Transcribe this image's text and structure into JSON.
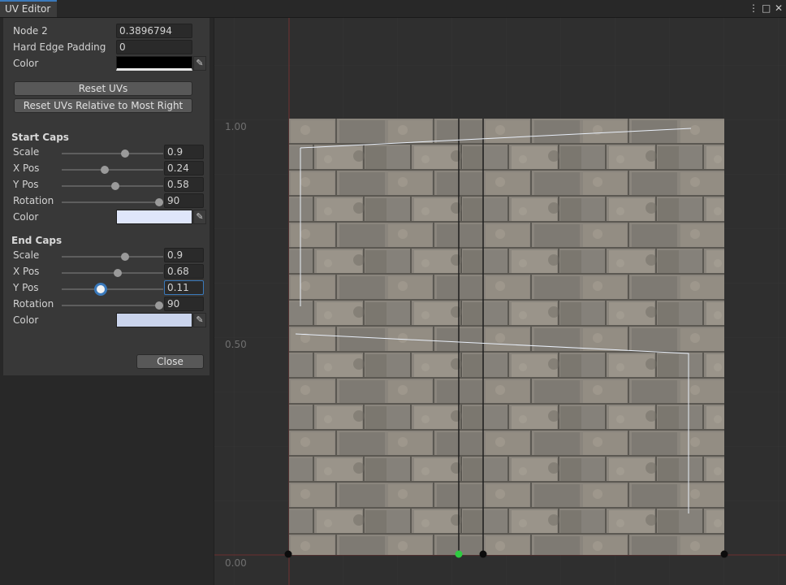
{
  "window": {
    "tab_title": "UV Editor",
    "menu_icon": "kebab-menu-icon",
    "maximize_icon": "maximize-icon",
    "close_icon": "close-icon"
  },
  "node": {
    "label": "Node 2",
    "value": "0.3896794",
    "padding_label": "Hard Edge Padding",
    "padding_value": "0",
    "color_label": "Color",
    "color_value": "#000000"
  },
  "buttons": {
    "reset_uvs": "Reset UVs",
    "reset_relative": "Reset UVs Relative to Most Right",
    "close": "Close"
  },
  "start_caps": {
    "title": "Start Caps",
    "sliders": [
      {
        "label": "Scale",
        "value": "0.9",
        "fraction": 0.62
      },
      {
        "label": "X Pos",
        "value": "0.24",
        "fraction": 0.42
      },
      {
        "label": "Y Pos",
        "value": "0.58",
        "fraction": 0.53
      },
      {
        "label": "Rotation",
        "value": "90",
        "fraction": 0.96
      }
    ],
    "color_label": "Color",
    "color_value": "#dfe6fb"
  },
  "end_caps": {
    "title": "End Caps",
    "sliders": [
      {
        "label": "Scale",
        "value": "0.9",
        "fraction": 0.62
      },
      {
        "label": "X Pos",
        "value": "0.68",
        "fraction": 0.55
      },
      {
        "label": "Y Pos",
        "value": "0.11",
        "fraction": 0.38
      },
      {
        "label": "Rotation",
        "value": "90",
        "fraction": 0.96
      }
    ],
    "color_label": "Color",
    "color_value": "#cad4ec"
  },
  "uv_view": {
    "axis_labels": [
      "1.00",
      "0.50",
      "0.00"
    ],
    "accent_point_color": "#2ecc40",
    "origin_line_color": "#7a2a2a"
  }
}
